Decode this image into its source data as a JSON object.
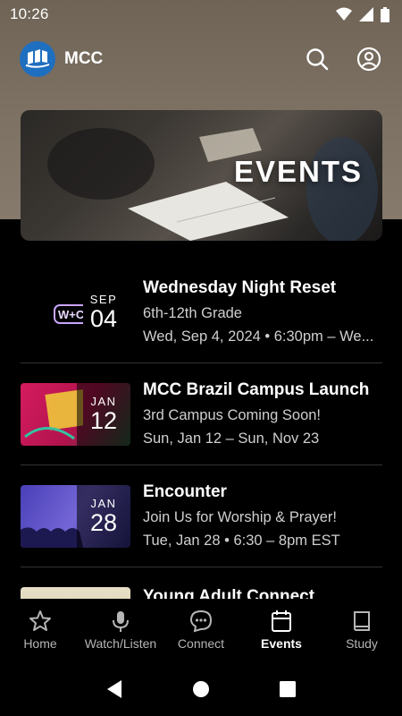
{
  "status": {
    "time": "10:26"
  },
  "app": {
    "title": "MCC"
  },
  "hero": {
    "title": "EVENTS"
  },
  "events": [
    {
      "month": "SEP",
      "day": "04",
      "title": "Wednesday Night Reset",
      "subtitle": "6th-12th Grade",
      "when": "Wed, Sep 4, 2024 • 6:30pm – We..."
    },
    {
      "month": "JAN",
      "day": "12",
      "title": "MCC Brazil Campus Launch",
      "subtitle": "3rd Campus Coming Soon!",
      "when": "Sun, Jan 12 – Sun, Nov 23"
    },
    {
      "month": "JAN",
      "day": "28",
      "title": "Encounter",
      "subtitle": "Join Us for Worship & Prayer!",
      "when": "Tue, Jan 28 • 6:30 – 8pm EST"
    },
    {
      "month": "",
      "day": "",
      "title": "Young Adult Connect",
      "subtitle": "",
      "when": ""
    }
  ],
  "nav": {
    "items": [
      {
        "label": "Home",
        "icon": "star-icon"
      },
      {
        "label": "Watch/Listen",
        "icon": "microphone-icon"
      },
      {
        "label": "Connect",
        "icon": "chat-bubble-icon"
      },
      {
        "label": "Events",
        "icon": "calendar-icon",
        "active": true
      },
      {
        "label": "Study",
        "icon": "book-icon"
      }
    ]
  },
  "colors": {
    "accent": "#1f6fc0",
    "background": "#000000"
  }
}
